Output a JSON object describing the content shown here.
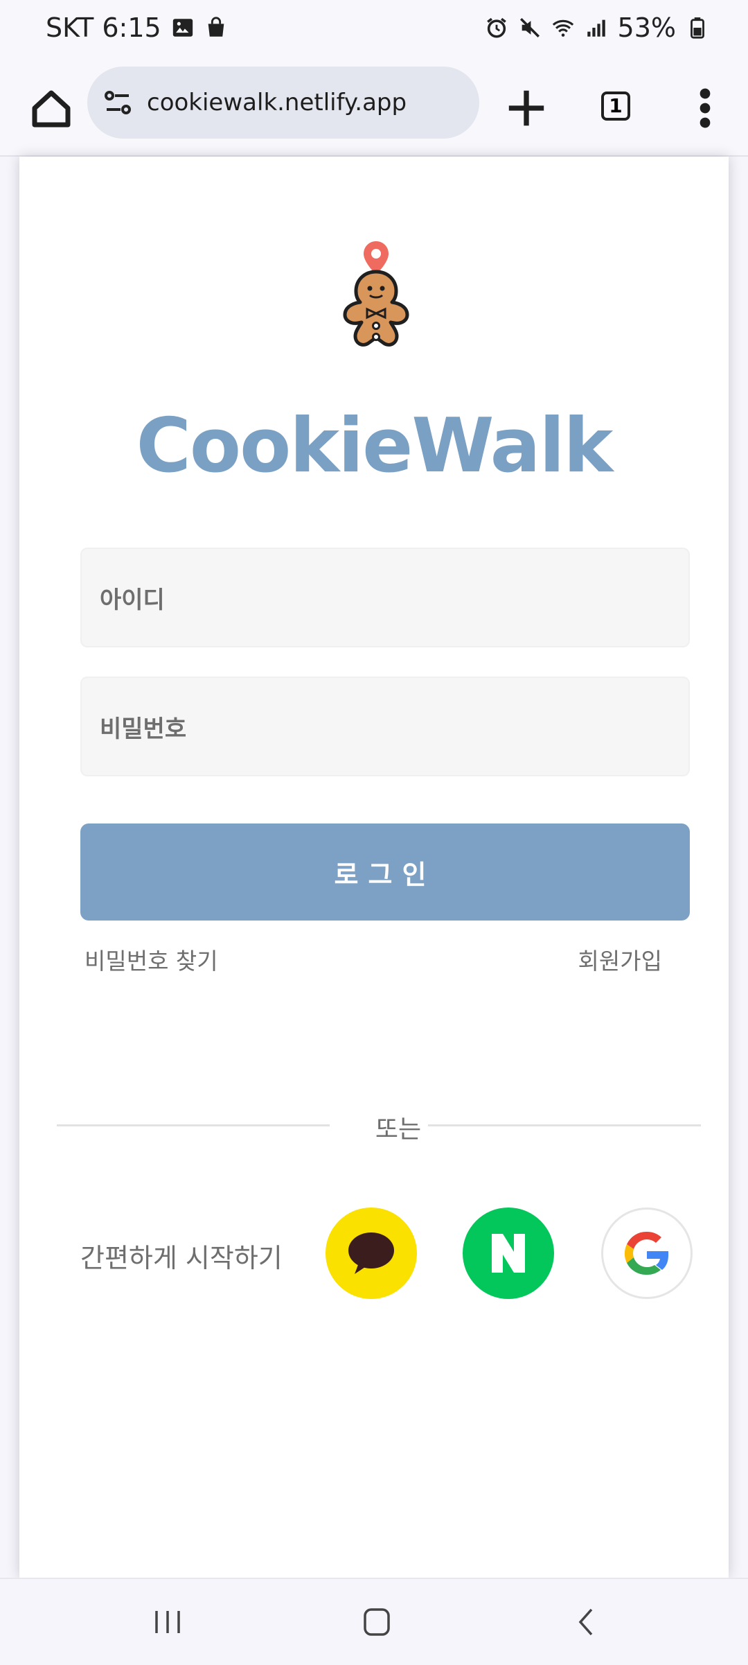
{
  "status_bar": {
    "carrier_time": "SKT 6:15",
    "battery": "53%",
    "icons_left": [
      "gallery-icon",
      "shopping-bag-icon"
    ],
    "icons_right": [
      "alarm-icon",
      "mute-icon",
      "wifi-icon",
      "signal-icon",
      "battery-icon"
    ]
  },
  "browser": {
    "url": "cookiewalk.netlify.app",
    "tab_count": "1"
  },
  "app": {
    "brand": "CookieWalk",
    "id_placeholder": "아이디",
    "password_placeholder": "비밀번호",
    "login_label": "로그인",
    "find_password": "비밀번호 찾기",
    "signup": "회원가입",
    "divider_text": "또는",
    "quick_start": "간편하게 시작하기",
    "social_buttons": [
      "kakao",
      "naver",
      "google"
    ]
  },
  "colors": {
    "brand": "#7aa0c4",
    "login_button": "#7da1c4",
    "kakao": "#fae100",
    "naver": "#03c75a"
  }
}
